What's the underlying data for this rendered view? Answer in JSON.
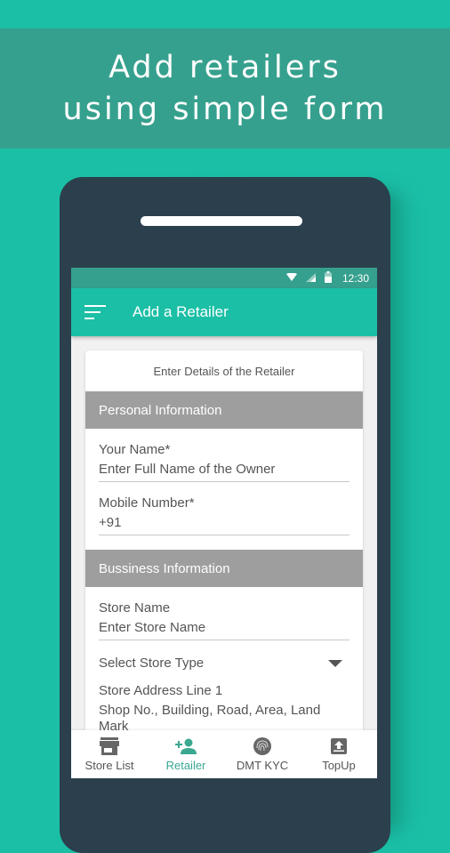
{
  "banner": {
    "line1": "Add retailers",
    "line2": "using simple form"
  },
  "status_bar": {
    "icons": [
      "wifi-icon",
      "signal-icon",
      "battery-icon"
    ],
    "time": "12:30"
  },
  "app_bar": {
    "menu_icon": "menu-icon",
    "title": "Add a Retailer"
  },
  "form": {
    "title": "Enter Details of the Retailer",
    "sections": {
      "personal": {
        "header": "Personal Information",
        "name_label": "Your Name*",
        "name_placeholder": "Enter Full Name of the Owner",
        "mobile_label": "Mobile Number*",
        "mobile_value": "+91"
      },
      "business": {
        "header": "Bussiness Information",
        "store_name_label": "Store Name",
        "store_name_placeholder": "Enter Store Name",
        "store_type_select": "Select Store Type",
        "address_label": "Store Address Line 1",
        "address_placeholder": "Shop No., Building, Road, Area, Land Mark"
      }
    }
  },
  "bottom_nav": {
    "items": [
      {
        "label": "Store List",
        "icon": "store-icon",
        "active": false
      },
      {
        "label": "Retailer",
        "icon": "add-person-icon",
        "active": true
      },
      {
        "label": "DMT KYC",
        "icon": "fingerprint-icon",
        "active": false
      },
      {
        "label": "TopUp",
        "icon": "upload-icon",
        "active": false
      }
    ]
  },
  "colors": {
    "background": "#1bbfa6",
    "banner": "#36a08e",
    "phone_body": "#2b3f4c",
    "app_bar": "#1bbfa6",
    "section_header": "#9e9e9e",
    "active_nav": "#3aa891"
  }
}
